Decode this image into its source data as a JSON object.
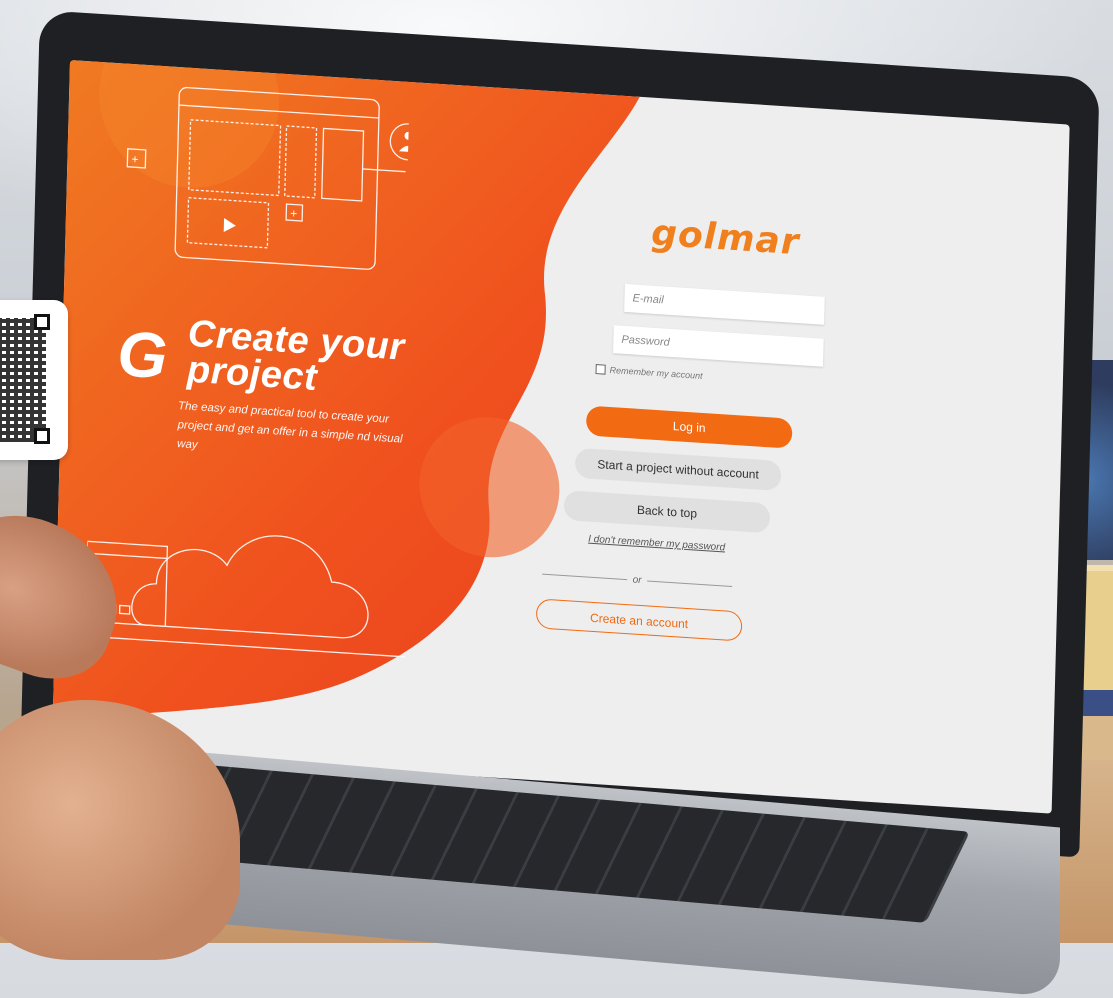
{
  "hero": {
    "title_line1": "Create your",
    "title_line2": "project",
    "subtitle": "The easy and practical tool to create your project and get an offer in a simple nd visual way"
  },
  "brand": {
    "logo_text": "golmar",
    "accent_color": "#f26a12"
  },
  "login": {
    "email_placeholder": "E-mail",
    "password_placeholder": "Password",
    "remember_label": "Remember my account",
    "login_button": "Log in",
    "guest_button": "Start a project without account",
    "back_button": "Back to top",
    "forgot_link": "I don't remember my password",
    "or_label": "or",
    "create_account_button": "Create an account"
  },
  "icons": {
    "info": "info-icon",
    "user": "user-icon",
    "qr": "qr-code-icon"
  }
}
